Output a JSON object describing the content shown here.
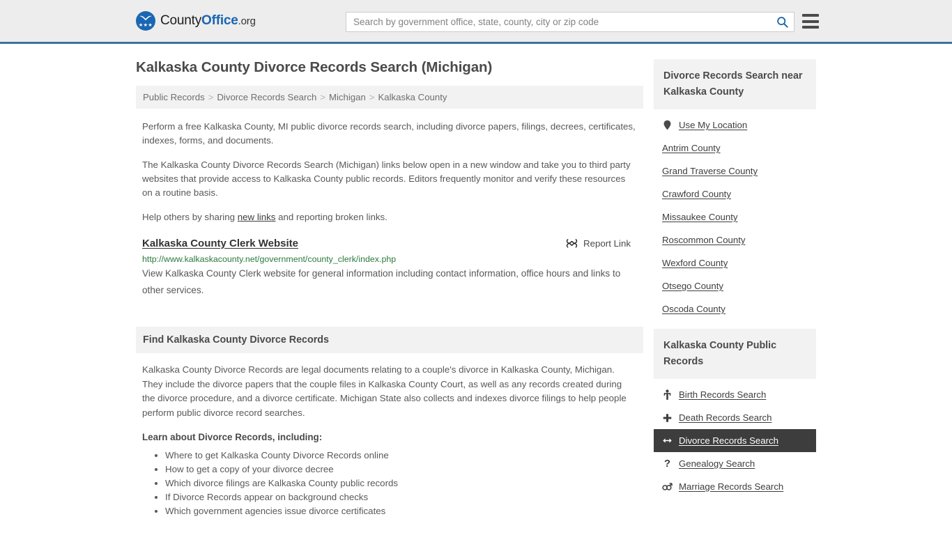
{
  "header": {
    "logo_text_1": "County",
    "logo_text_2": "Office",
    "logo_text_3": ".org",
    "search_placeholder": "Search by government office, state, county, city or zip code",
    "search_value": "",
    "search_icon": "search-icon",
    "menu_icon": "hamburger-menu-icon"
  },
  "main": {
    "title": "Kalkaska County Divorce Records Search (Michigan)",
    "breadcrumb": [
      "Public Records",
      "Divorce Records Search",
      "Michigan",
      "Kalkaska County"
    ],
    "breadcrumb_separator": ">",
    "intro_1": "Perform a free Kalkaska County, MI public divorce records search, including divorce papers, filings, decrees, certificates, indexes, forms, and documents.",
    "intro_2": "The Kalkaska County Divorce Records Search (Michigan) links below open in a new window and take you to third party websites that provide access to Kalkaska County public records. Editors frequently monitor and verify these resources on a routine basis.",
    "help_prefix": "Help others by sharing ",
    "help_link": "new links",
    "help_suffix": " and reporting broken links.",
    "link_entry": {
      "title": "Kalkaska County Clerk Website",
      "report_label": "Report Link",
      "report_icon": "broken-link-icon",
      "url": "http://www.kalkaskacounty.net/government/county_clerk/index.php",
      "description": "View Kalkaska County Clerk website for general information including contact information, office hours and links to other services."
    },
    "section": {
      "heading": "Find Kalkaska County Divorce Records",
      "paragraph": "Kalkaska County Divorce Records are legal documents relating to a couple's divorce in Kalkaska County, Michigan. They include the divorce papers that the couple files in Kalkaska County Court, as well as any records created during the divorce procedure, and a divorce certificate. Michigan State also collects and indexes divorce filings to help people perform public divorce record searches.",
      "learn_heading": "Learn about Divorce Records, including:",
      "learn_items": [
        "Where to get Kalkaska County Divorce Records online",
        "How to get a copy of your divorce decree",
        "Which divorce filings are Kalkaska County public records",
        "If Divorce Records appear on background checks",
        "Which government agencies issue divorce certificates"
      ]
    }
  },
  "sidebar": {
    "nearby": {
      "heading": "Divorce Records Search near Kalkaska County",
      "items": [
        {
          "label": "Use My Location",
          "icon": "map-pin-icon",
          "active": false
        },
        {
          "label": "Antrim County",
          "icon": "",
          "active": false
        },
        {
          "label": "Grand Traverse County",
          "icon": "",
          "active": false
        },
        {
          "label": "Crawford County",
          "icon": "",
          "active": false
        },
        {
          "label": "Missaukee County",
          "icon": "",
          "active": false
        },
        {
          "label": "Roscommon County",
          "icon": "",
          "active": false
        },
        {
          "label": "Wexford County",
          "icon": "",
          "active": false
        },
        {
          "label": "Otsego County",
          "icon": "",
          "active": false
        },
        {
          "label": "Oscoda County",
          "icon": "",
          "active": false
        }
      ]
    },
    "public_records": {
      "heading": "Kalkaska County Public Records",
      "items": [
        {
          "label": "Birth Records Search",
          "icon": "baby-icon",
          "active": false
        },
        {
          "label": "Death Records Search",
          "icon": "cross-icon",
          "active": false
        },
        {
          "label": "Divorce Records Search",
          "icon": "left-right-arrow-icon",
          "active": true
        },
        {
          "label": "Genealogy Search",
          "icon": "question-mark-icon",
          "active": false
        },
        {
          "label": "Marriage Records Search",
          "icon": "gender-symbols-icon",
          "active": false
        }
      ]
    }
  },
  "colors": {
    "brand_blue": "#1a66b3",
    "header_border": "#3d72a4",
    "url_green": "#2c7a3d",
    "active_bg": "#3d3d3d",
    "panel_gray": "#f2f2f2"
  }
}
